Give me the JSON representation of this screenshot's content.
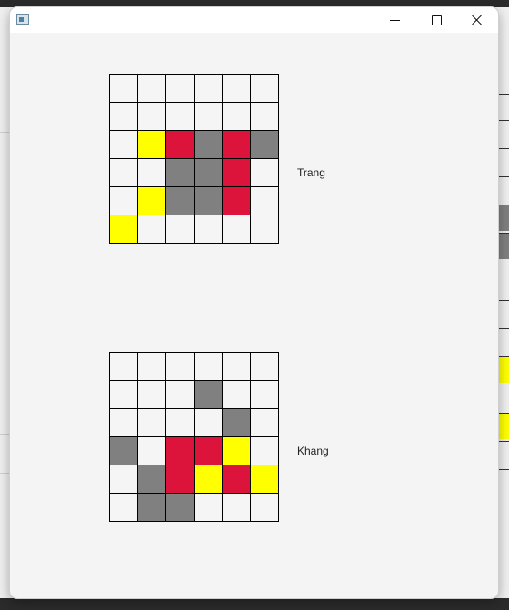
{
  "window": {
    "title": "",
    "icon": "app-window-icon",
    "controls": [
      "minimize-icon",
      "maximize-icon",
      "close-icon"
    ]
  },
  "colors": {
    "empty": "#f5f5f5",
    "yellow": "#ffff00",
    "red": "#dc143c",
    "gray": "#808080",
    "grid_line": "#000000",
    "window_bg": "#f4f4f4"
  },
  "boards": [
    {
      "player": "Trang",
      "grid": [
        [
          "empty",
          "empty",
          "empty",
          "empty",
          "empty",
          "empty"
        ],
        [
          "empty",
          "empty",
          "empty",
          "empty",
          "empty",
          "empty"
        ],
        [
          "empty",
          "yellow",
          "red",
          "gray",
          "red",
          "gray"
        ],
        [
          "empty",
          "empty",
          "gray",
          "gray",
          "red",
          "empty"
        ],
        [
          "empty",
          "yellow",
          "gray",
          "gray",
          "red",
          "empty"
        ],
        [
          "yellow",
          "empty",
          "empty",
          "empty",
          "empty",
          "empty"
        ]
      ]
    },
    {
      "player": "Khang",
      "grid": [
        [
          "empty",
          "empty",
          "empty",
          "empty",
          "empty",
          "empty"
        ],
        [
          "empty",
          "empty",
          "empty",
          "gray",
          "empty",
          "empty"
        ],
        [
          "empty",
          "empty",
          "empty",
          "empty",
          "gray",
          "empty"
        ],
        [
          "gray",
          "empty",
          "red",
          "red",
          "yellow",
          "empty"
        ],
        [
          "empty",
          "gray",
          "red",
          "yellow",
          "red",
          "yellow"
        ],
        [
          "empty",
          "gray",
          "gray",
          "empty",
          "empty",
          "empty"
        ]
      ]
    }
  ]
}
